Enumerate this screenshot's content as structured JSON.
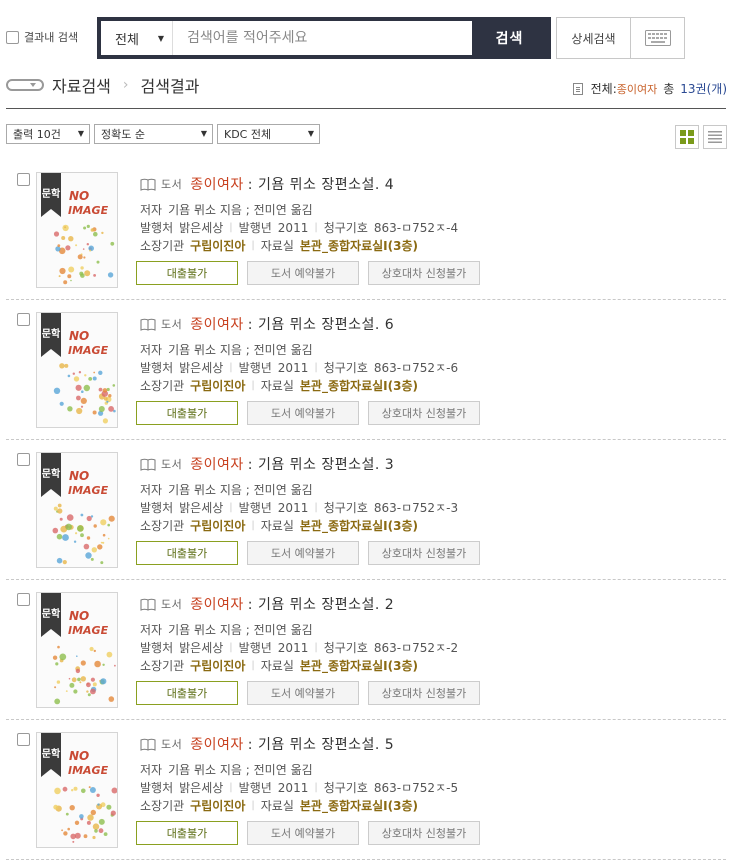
{
  "colors": {
    "navy": "#2e3342",
    "highlight": "#c8401f",
    "gold": "#8b6a12",
    "olive": "#8aa020"
  },
  "search": {
    "within_label": "결과내 검색",
    "scope": "전체",
    "placeholder": "검색어를 적어주세요",
    "button": "검색",
    "advanced": "상세검색",
    "keyboard_icon": "keyboard-icon"
  },
  "breadcrumb": {
    "home_icon": "home-icon",
    "section": "자료검색",
    "current": "검색결과"
  },
  "total": {
    "prefix": "전체:",
    "query": "종이여자",
    "count_label": "총",
    "count": "13권(개)"
  },
  "filters": {
    "page_size": "출력 10건",
    "sort": "정확도 순",
    "kdc": "KDC 전체"
  },
  "views": {
    "grid_icon": "grid-view-icon",
    "list_icon": "list-view-icon"
  },
  "labels": {
    "author": "저자",
    "publisher": "발행처",
    "year": "발행년",
    "call": "청구기호",
    "holder": "소장기관",
    "room": "자료실",
    "type": "도서",
    "cover_badge": "문학",
    "cover_no": "NO",
    "cover_image": "IMAGE"
  },
  "results": [
    {
      "highlight": "종이여자",
      "rest": ": 기욤 뮈소 장편소설. 4",
      "author": "기욤 뮈소 지음 ; 전미연 옮김",
      "publisher": "밝은세상",
      "year": "2011",
      "call": "863-ㅁ752ㅈ-4",
      "holder": "구립이진아",
      "room": "본관_종합자료실Ⅰ(3층)",
      "btn1": "대출불가",
      "btn2": "도서 예약불가",
      "btn3": "상호대차 신청불가"
    },
    {
      "highlight": "종이여자",
      "rest": ": 기욤 뮈소 장편소설. 6",
      "author": "기욤 뮈소 지음 ; 전미연 옮김",
      "publisher": "밝은세상",
      "year": "2011",
      "call": "863-ㅁ752ㅈ-6",
      "holder": "구립이진아",
      "room": "본관_종합자료실Ⅰ(3층)",
      "btn1": "대출불가",
      "btn2": "도서 예약불가",
      "btn3": "상호대차 신청불가"
    },
    {
      "highlight": "종이여자",
      "rest": ": 기욤 뮈소 장편소설. 3",
      "author": "기욤 뮈소 지음 ; 전미연 옮김",
      "publisher": "밝은세상",
      "year": "2011",
      "call": "863-ㅁ752ㅈ-3",
      "holder": "구립이진아",
      "room": "본관_종합자료실Ⅰ(3층)",
      "btn1": "대출불가",
      "btn2": "도서 예약불가",
      "btn3": "상호대차 신청불가"
    },
    {
      "highlight": "종이여자",
      "rest": ": 기욤 뮈소 장편소설. 2",
      "author": "기욤 뮈소 지음 ; 전미연 옮김",
      "publisher": "밝은세상",
      "year": "2011",
      "call": "863-ㅁ752ㅈ-2",
      "holder": "구립이진아",
      "room": "본관_종합자료실Ⅰ(3층)",
      "btn1": "대출불가",
      "btn2": "도서 예약불가",
      "btn3": "상호대차 신청불가"
    },
    {
      "highlight": "종이여자",
      "rest": ": 기욤 뮈소 장편소설. 5",
      "author": "기욤 뮈소 지음 ; 전미연 옮김",
      "publisher": "밝은세상",
      "year": "2011",
      "call": "863-ㅁ752ㅈ-5",
      "holder": "구립이진아",
      "room": "본관_종합자료실Ⅰ(3층)",
      "btn1": "대출불가",
      "btn2": "도서 예약불가",
      "btn3": "상호대차 신청불가"
    }
  ]
}
